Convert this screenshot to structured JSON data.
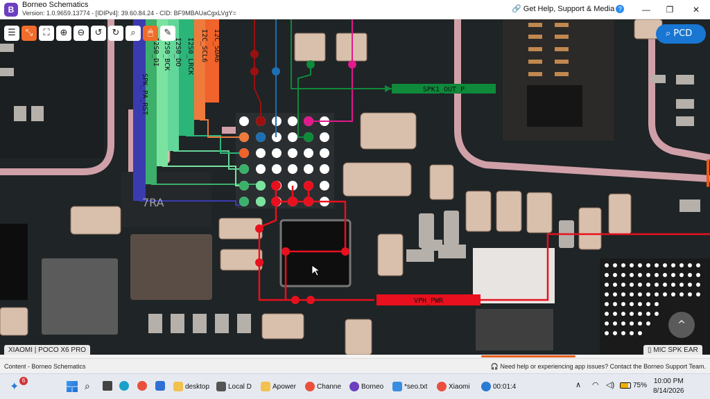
{
  "window": {
    "logo_letter": "B",
    "title": "Borneo Schematics",
    "version": "Version: 1.0.9659.13774 - [IDIPv4]: 39.60.84.24 - CID: BF9MBAUaCgxLVgY=",
    "help_link": "Get Help, Support & Media",
    "help_badge": "?",
    "minimize": "—",
    "maximize": "❐",
    "close": "✕"
  },
  "toolbar": {
    "tools": [
      "☰",
      "⤡",
      "⛶",
      "⊕",
      "⊖",
      "↺",
      "↻",
      "⌕",
      "🖱",
      "✎"
    ],
    "active_index": 1,
    "pcd_label": "PCD"
  },
  "board": {
    "signal_labels": [
      "SPK_PA_RST",
      "I2S0_DI",
      "I2S0_BCK",
      "I2S0_DO",
      "I2S0_LRCK",
      "I2C_SCL6",
      "I2C_SDA6"
    ],
    "net_spk": "SPK1_OUT_P",
    "net_vph": "VPH_PWR",
    "silk_text": "7RA",
    "model_tag": "XIAOMI | POCO X6 PRO",
    "section_tag": "MIC SPK EAR",
    "scroll_top_icon": "^"
  },
  "colors": {
    "accent_orange": "#f16c2a",
    "pcd_blue": "#1976d2",
    "net_red": "#e8101e",
    "net_green": "#0e8a3a",
    "net_magenta": "#e0198c",
    "pcb_pink": "#f0b6c0"
  },
  "status": {
    "left": "Content - Borneo Schematics",
    "right": "Need help or experiencing app issues? Contact the Borneo Support Team."
  },
  "taskbar": {
    "notification_count": "6",
    "apps": [
      "desktop",
      "Local D",
      "Apower",
      "Channe",
      "Borneo",
      "*seo.txt",
      "Xiaomi",
      "00:01:4"
    ],
    "battery": "75%",
    "time": "10:00 PM",
    "date": "8/14/2026"
  }
}
